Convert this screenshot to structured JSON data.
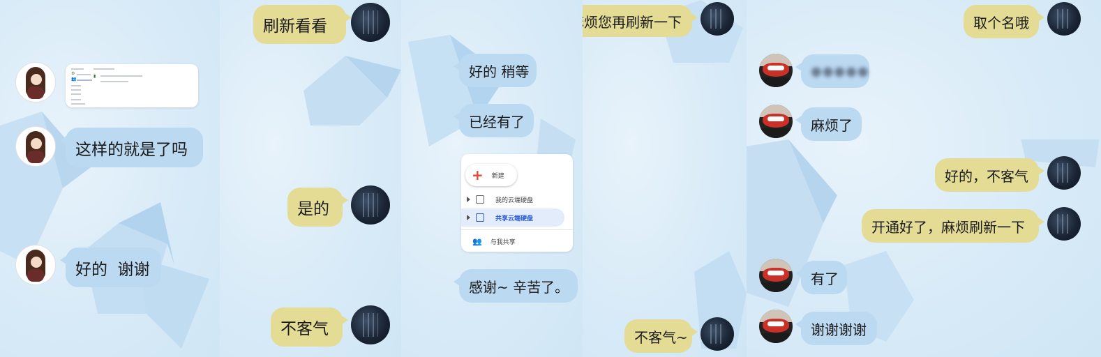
{
  "colors": {
    "self_bubble": "#e4dc95",
    "other_bubble": "#bcd9f2",
    "background": "#dcecf8",
    "drive_selected": "#e3ecfb",
    "drive_selected_text": "#2a5bd7"
  },
  "panel1": {
    "attachment_icons": [
      "gear-icon",
      "people-icon",
      "folder-icon"
    ],
    "messages": [
      {
        "text": "这样的就是了吗"
      },
      {
        "text": "好的  谢谢"
      }
    ]
  },
  "panel2": {
    "messages": [
      {
        "text": "刷新看看"
      },
      {
        "text": "好的 稍等"
      },
      {
        "text": "已经有了"
      },
      {
        "text": "是的"
      },
      {
        "text": "感谢~ 辛苦了。"
      },
      {
        "text": "不客气"
      }
    ],
    "drive_menu": {
      "new_button": "新建",
      "items": [
        {
          "label": "我的云端硬盘",
          "icon": "drive-icon",
          "selected": false
        },
        {
          "label": "共享云端硬盘",
          "icon": "shared-drive-icon",
          "selected": true
        },
        {
          "label": "与我共享",
          "icon": "people-icon",
          "selected": false
        }
      ]
    }
  },
  "panel3": {
    "messages": [
      {
        "text": "好了，麻烦您再刷新一下"
      },
      {
        "text": "不客气~"
      }
    ]
  },
  "panel4": {
    "messages": [
      {
        "text": "取个名哦"
      },
      {
        "text": "●●●●●"
      },
      {
        "text": "麻烦了"
      },
      {
        "text": "好的，不客气"
      },
      {
        "text": "开通好了，麻烦刷新一下"
      },
      {
        "text": "有了"
      },
      {
        "text": "谢谢谢谢"
      }
    ]
  }
}
